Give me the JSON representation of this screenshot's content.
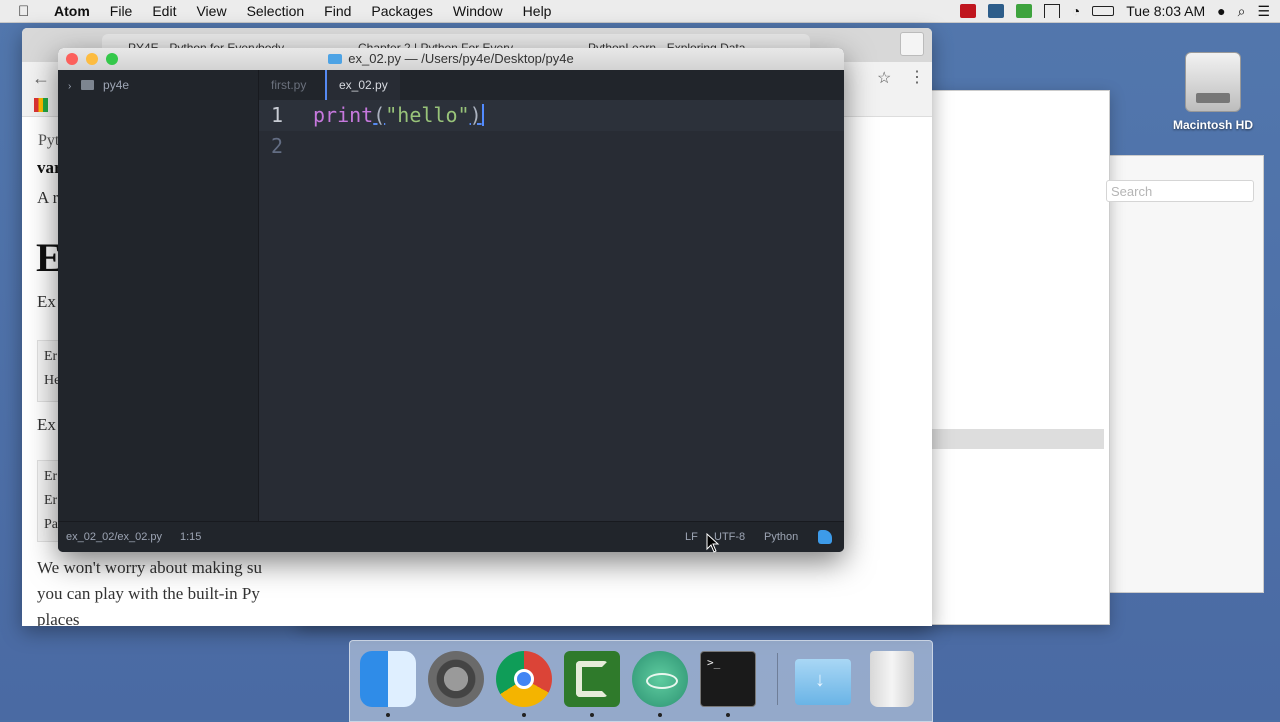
{
  "menubar": {
    "app": "Atom",
    "items": [
      "File",
      "Edit",
      "View",
      "Selection",
      "Find",
      "Packages",
      "Window",
      "Help"
    ],
    "clock": "Tue 8:03 AM"
  },
  "chrome": {
    "tabs": [
      {
        "label": "PY4E - Python for Everybody"
      },
      {
        "label": "Chapter 2 | Python For Every"
      },
      {
        "label": "PythonLearn - Exploring Data"
      }
    ],
    "page_fragments": {
      "crumb": "Pyt",
      "bold": "var",
      "line_a": "A r",
      "heading": "E",
      "line_ex1": "Ex",
      "box1_l1": "Er",
      "box1_l2": "He",
      "line_ex2": "Ex",
      "box2_l1": "Er",
      "box2_l2": "Er",
      "box2_l3": "Pa",
      "para_l1": "We won't worry about making su",
      "para_l2": "you can play with the built-in Py",
      "para_l3": "places"
    }
  },
  "finder": {
    "search_placeholder": "Search"
  },
  "desktop": {
    "hd_label": "Macintosh HD"
  },
  "atom": {
    "title": "ex_02.py — /Users/py4e/Desktop/py4e",
    "tree_root": "py4e",
    "tabs": [
      {
        "label": "first.py",
        "active": false
      },
      {
        "label": "ex_02.py",
        "active": true
      }
    ],
    "code": {
      "line_numbers": [
        "1",
        "2"
      ],
      "func": "print",
      "open": "(",
      "string": "\"hello\"",
      "close": ")"
    },
    "status": {
      "path": "ex_02_02/ex_02.py",
      "cursor": "1:15",
      "line_ending": "LF",
      "encoding": "UTF-8",
      "grammar": "Python"
    }
  },
  "dock": {
    "apps": [
      "finder",
      "system-preferences",
      "chrome",
      "camtasia",
      "atom",
      "terminal",
      "downloads",
      "trash"
    ]
  },
  "colors": {
    "atom_bg": "#282c34",
    "keyword": "#c678dd",
    "string": "#98c379",
    "accent": "#568af2"
  }
}
